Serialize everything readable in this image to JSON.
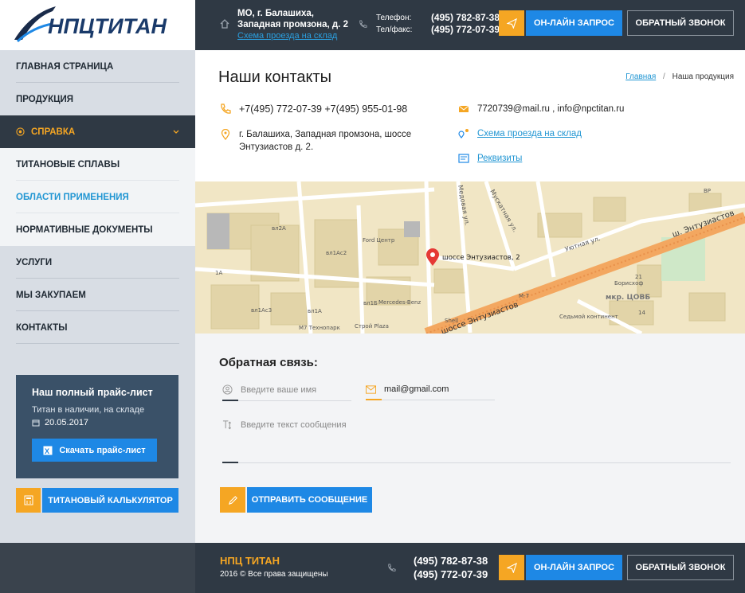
{
  "header": {
    "logo_text": "НПЦТИТАН",
    "address_line1": "МО, г. Балашиха,",
    "address_line2": "Западная промзона, д. 2",
    "address_link": "Схема проезда на склад",
    "phone_label": "Телефон:",
    "phone": "(495) 782-87-38",
    "fax_label": "Тел/факс:",
    "fax": "(495) 772-07-39",
    "online_btn": "ОН-ЛАЙН ЗАПРОС",
    "call_btn": "ОБРАТНЫЙ ЗВОНОК"
  },
  "sidebar": {
    "items": [
      {
        "label": "ГЛАВНАЯ СТРАНИЦА"
      },
      {
        "label": "ПРОДУКЦИЯ"
      },
      {
        "label": "СПРАВКА"
      },
      {
        "label": "ТИТАНОВЫЕ СПЛАВЫ"
      },
      {
        "label": "ОБЛАСТИ ПРИМЕНЕНИЯ"
      },
      {
        "label": "НОРМАТИВНЫЕ ДОКУМЕНТЫ"
      },
      {
        "label": "УСЛУГИ"
      },
      {
        "label": "МЫ ЗАКУПАЕМ"
      },
      {
        "label": "КОНТАКТЫ"
      }
    ],
    "price": {
      "title": "Наш полный прайс-лист",
      "subtitle": "Титан в наличии, на складе",
      "date": "20.05.2017",
      "download": "Скачать прайс-лист"
    },
    "calc_btn": "ТИТАНОВЫЙ КАЛЬКУЛЯТОР"
  },
  "main": {
    "title": "Наши контакты",
    "breadcrumb": {
      "home": "Главная",
      "sep": "/",
      "current": "Наша продукция"
    },
    "phones": "+7(495) 772-07-39 +7(495) 955-01-98",
    "address": "г. Балашиха, Западная промзона, шоссе Энтузиастов д. 2.",
    "emails": "7720739@mail.ru , info@npctitan.ru",
    "scheme_link": "Схема проезда на склад",
    "requisites_link": "Реквизиты"
  },
  "map": {
    "streets": [
      "Медовая ул.",
      "Мускатная ул.",
      "Уютная ул.",
      "ш. Энтузиастов",
      "шоссе Энтузиастов"
    ],
    "places": [
      "Ford Центр",
      "Mercedes-Benz",
      "М7 Технопарк",
      "Строй Plaza",
      "Shell",
      "Седьмой континент",
      "Борисхоф",
      "мкр. ЦОВБ"
    ],
    "labels": [
      "вл2А",
      "вл1Ас2",
      "1А",
      "вл1Ас3",
      "вл1А",
      "вл1Б",
      "М-7",
      "21",
      "14",
      "BP"
    ],
    "pin_label": "шоссе Энтузиастов, 2"
  },
  "feedback": {
    "title": "Обратная связь:",
    "name_placeholder": "Введите ваше имя",
    "email_value": "mail@gmail.com",
    "message_placeholder": "Введите текст сообщения",
    "send_btn": "ОТПРАВИТЬ СООБЩЕНИЕ"
  },
  "footer": {
    "brand": "НПЦ ТИТАН",
    "copyright": "2016 © Все права защищены",
    "phone1": "(495) 782-87-38",
    "phone2": "(495) 772-07-39",
    "online_btn": "ОН-ЛАЙН ЗАПРОС",
    "call_btn": "ОБРАТНЫЙ ЗВОНОК"
  },
  "colors": {
    "dark": "#2f3944",
    "accent": "#f5a623",
    "blue": "#1e88e5",
    "link": "#2196d3"
  }
}
